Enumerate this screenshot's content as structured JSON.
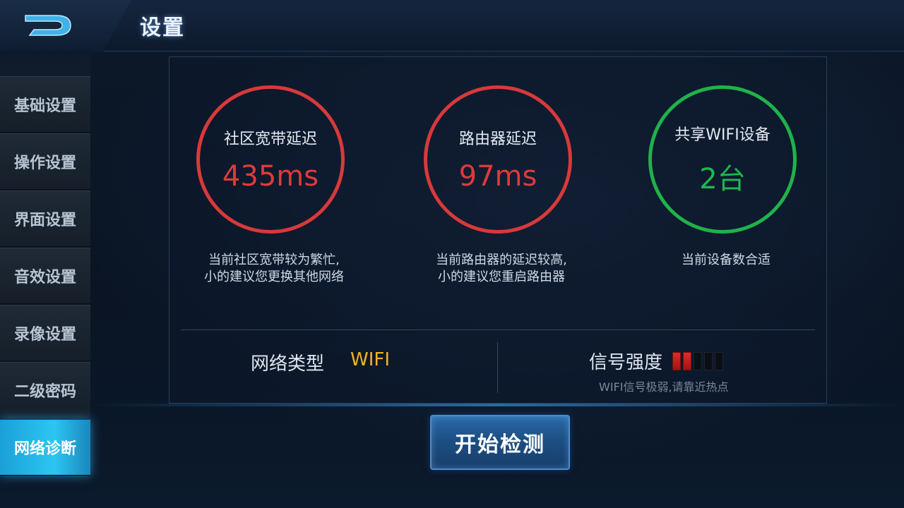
{
  "header": {
    "title": "设置",
    "logo_icon": "d-logo-icon"
  },
  "sidebar": {
    "items": [
      {
        "label": "基础设置",
        "active": false
      },
      {
        "label": "操作设置",
        "active": false
      },
      {
        "label": "界面设置",
        "active": false
      },
      {
        "label": "音效设置",
        "active": false
      },
      {
        "label": "录像设置",
        "active": false
      },
      {
        "label": "二级密码",
        "active": false
      },
      {
        "label": "网络诊断",
        "active": true
      }
    ]
  },
  "metrics": [
    {
      "label": "社区宽带延迟",
      "value": "435ms",
      "status": "bad",
      "note": "当前社区宽带较为繁忙,\n小的建议您更换其他网络"
    },
    {
      "label": "路由器延迟",
      "value": "97ms",
      "status": "bad",
      "note": "当前路由器的延迟较高,\n小的建议您重启路由器"
    },
    {
      "label": "共享WIFI设备",
      "value": "2台",
      "status": "good",
      "note": "当前设备数合适"
    }
  ],
  "network": {
    "type_label": "网络类型",
    "type_value": "WIFI"
  },
  "signal": {
    "label": "信号强度",
    "level": 2,
    "max": 5,
    "note": "WIFI信号极弱,请靠近热点"
  },
  "actions": {
    "start_label": "开始检测"
  },
  "colors": {
    "bad": "#d8393a",
    "good": "#1fb24a",
    "wifi": "#f3b325",
    "active_tab": "#2cc6f2"
  }
}
